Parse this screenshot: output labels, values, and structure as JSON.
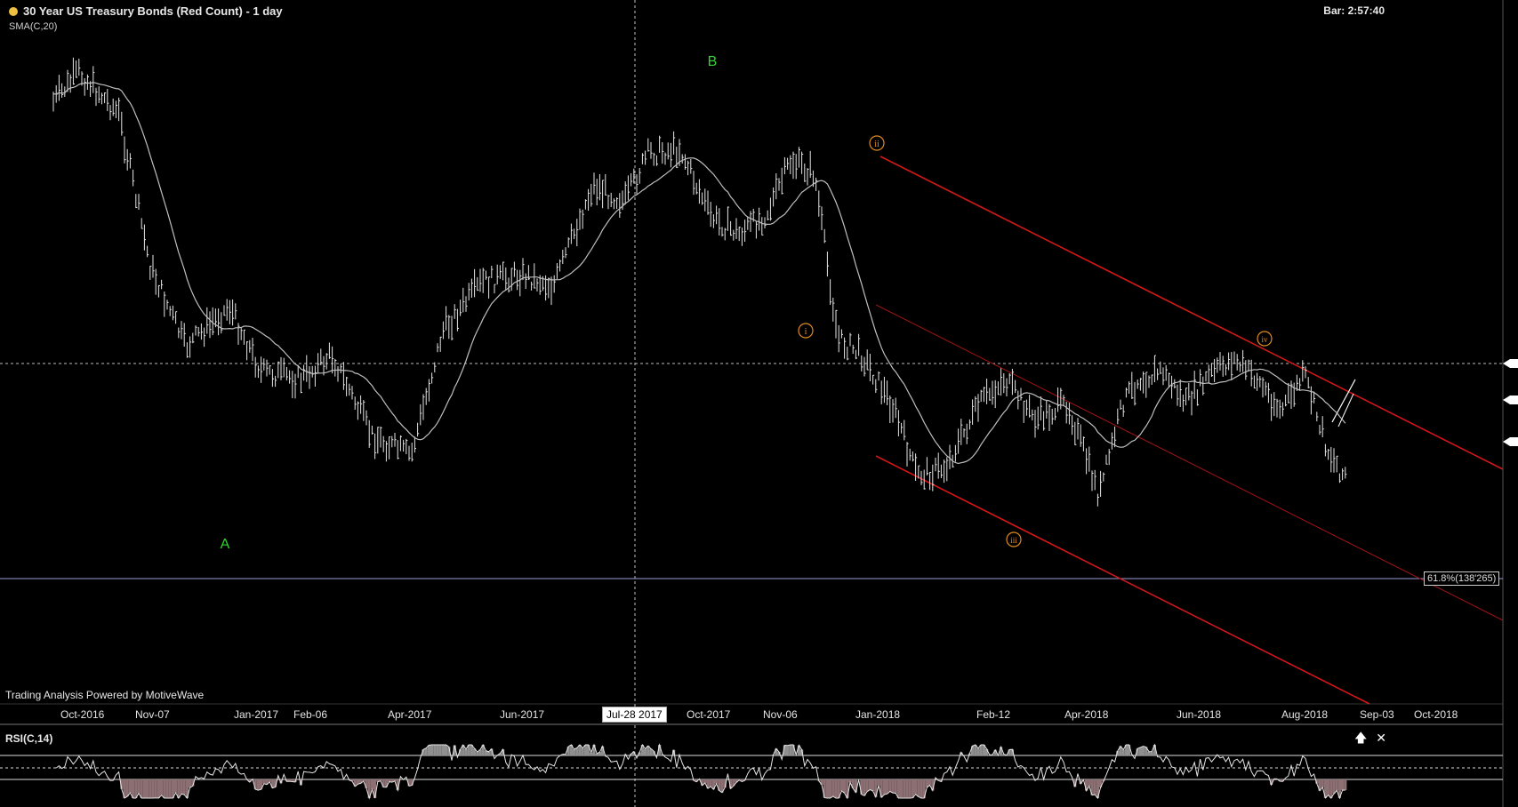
{
  "header": {
    "title": "30 Year US Treasury Bonds (Red Count) - 1 day",
    "indicator": "SMA(C,20)",
    "bar_timer": "Bar: 2:57:40",
    "branding": "Trading Analysis Powered by MotiveWave"
  },
  "crosshair": {
    "date_label": "Jul-28 2017"
  },
  "fib": {
    "label": "61.8%(138'265)"
  },
  "rsi_panel": {
    "label": "RSI(C,14)",
    "controls": {
      "up": "🡅",
      "close": "✕"
    }
  },
  "colors": {
    "background": "#000000",
    "bars": "#e6e6e6",
    "sma": "#bfbfbf",
    "channel": "#d01818",
    "wave_minor": "#e08a20",
    "wave_major": "#2fd62f",
    "rsi_oversold_fill": "#8c6f72",
    "rsi_overbought_fill": "#8f8f8f"
  },
  "chart_data": {
    "type": "line",
    "x_ticks": [
      "Oct-2016",
      "Nov-07",
      "Jan-2017",
      "Feb-06",
      "Apr-2017",
      "Jun-2017",
      "Oct-2017",
      "Nov-06",
      "Jan-2018",
      "Feb-12",
      "Apr-2018",
      "Jun-2018",
      "Aug-2018",
      "Sep-03",
      "Oct-2018"
    ],
    "wave_labels": [
      {
        "label": "A",
        "kind": "major"
      },
      {
        "label": "B",
        "kind": "major"
      },
      {
        "label": "i",
        "kind": "minor"
      },
      {
        "label": "ii",
        "kind": "minor"
      },
      {
        "label": "iii",
        "kind": "minor"
      },
      {
        "label": "iv",
        "kind": "minor"
      }
    ],
    "price_path_key_points": [
      [
        0,
        180
      ],
      [
        55,
        140
      ],
      [
        100,
        90
      ],
      [
        150,
        140
      ],
      [
        190,
        330
      ],
      [
        235,
        430
      ],
      [
        290,
        380
      ],
      [
        330,
        460
      ],
      [
        380,
        470
      ],
      [
        420,
        440
      ],
      [
        470,
        540
      ],
      [
        520,
        565
      ],
      [
        560,
        410
      ],
      [
        610,
        350
      ],
      [
        660,
        340
      ],
      [
        700,
        355
      ],
      [
        750,
        230
      ],
      [
        790,
        250
      ],
      [
        820,
        190
      ],
      [
        860,
        185
      ],
      [
        900,
        270
      ],
      [
        935,
        290
      ],
      [
        970,
        265
      ],
      [
        1000,
        200
      ],
      [
        1030,
        215
      ],
      [
        1060,
        420
      ],
      [
        1090,
        440
      ],
      [
        1130,
        505
      ],
      [
        1160,
        590
      ],
      [
        1195,
        580
      ],
      [
        1240,
        500
      ],
      [
        1270,
        470
      ],
      [
        1310,
        520
      ],
      [
        1350,
        500
      ],
      [
        1390,
        615
      ],
      [
        1420,
        500
      ],
      [
        1440,
        470
      ],
      [
        1470,
        460
      ],
      [
        1500,
        500
      ],
      [
        1530,
        465
      ],
      [
        1560,
        445
      ],
      [
        1590,
        470
      ],
      [
        1620,
        510
      ],
      [
        1650,
        465
      ],
      [
        1680,
        560
      ],
      [
        1700,
        590
      ],
      [
        1735,
        500
      ],
      [
        1760,
        490
      ],
      [
        1800,
        485
      ],
      [
        1830,
        490
      ],
      [
        1860,
        455
      ],
      [
        1890,
        500
      ],
      [
        1920,
        480
      ]
    ],
    "rsi_levels": {
      "upper": 70,
      "mid": 50,
      "lower": 30
    },
    "grid": false,
    "legend": "none"
  }
}
